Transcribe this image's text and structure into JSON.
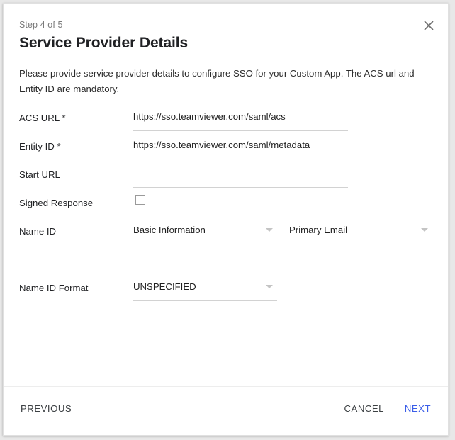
{
  "dialog": {
    "step_label": "Step 4 of 5",
    "title": "Service Provider Details",
    "description": "Please provide service provider details to configure SSO for your Custom App. The ACS url and Entity ID are mandatory.",
    "close_icon": "close-icon"
  },
  "form": {
    "acs_url": {
      "label": "ACS URL *",
      "value": "https://sso.teamviewer.com/saml/acs",
      "placeholder": ""
    },
    "entity_id": {
      "label": "Entity ID *",
      "value": "https://sso.teamviewer.com/saml/metadata",
      "placeholder": ""
    },
    "start_url": {
      "label": "Start URL",
      "value": "",
      "placeholder": ""
    },
    "signed_response": {
      "label": "Signed Response",
      "checked": false
    },
    "name_id": {
      "label": "Name ID",
      "category_value": "Basic Information",
      "attribute_value": "Primary Email"
    },
    "name_id_format": {
      "label": "Name ID Format",
      "value": "UNSPECIFIED"
    }
  },
  "footer": {
    "previous_label": "PREVIOUS",
    "cancel_label": "CANCEL",
    "next_label": "NEXT"
  },
  "colors": {
    "accent": "#3b5ee8",
    "text": "#202124",
    "muted": "#7b7b7b",
    "underline": "#d2d2d2",
    "page_background": "#e8e8e8",
    "card_background": "#ffffff"
  }
}
